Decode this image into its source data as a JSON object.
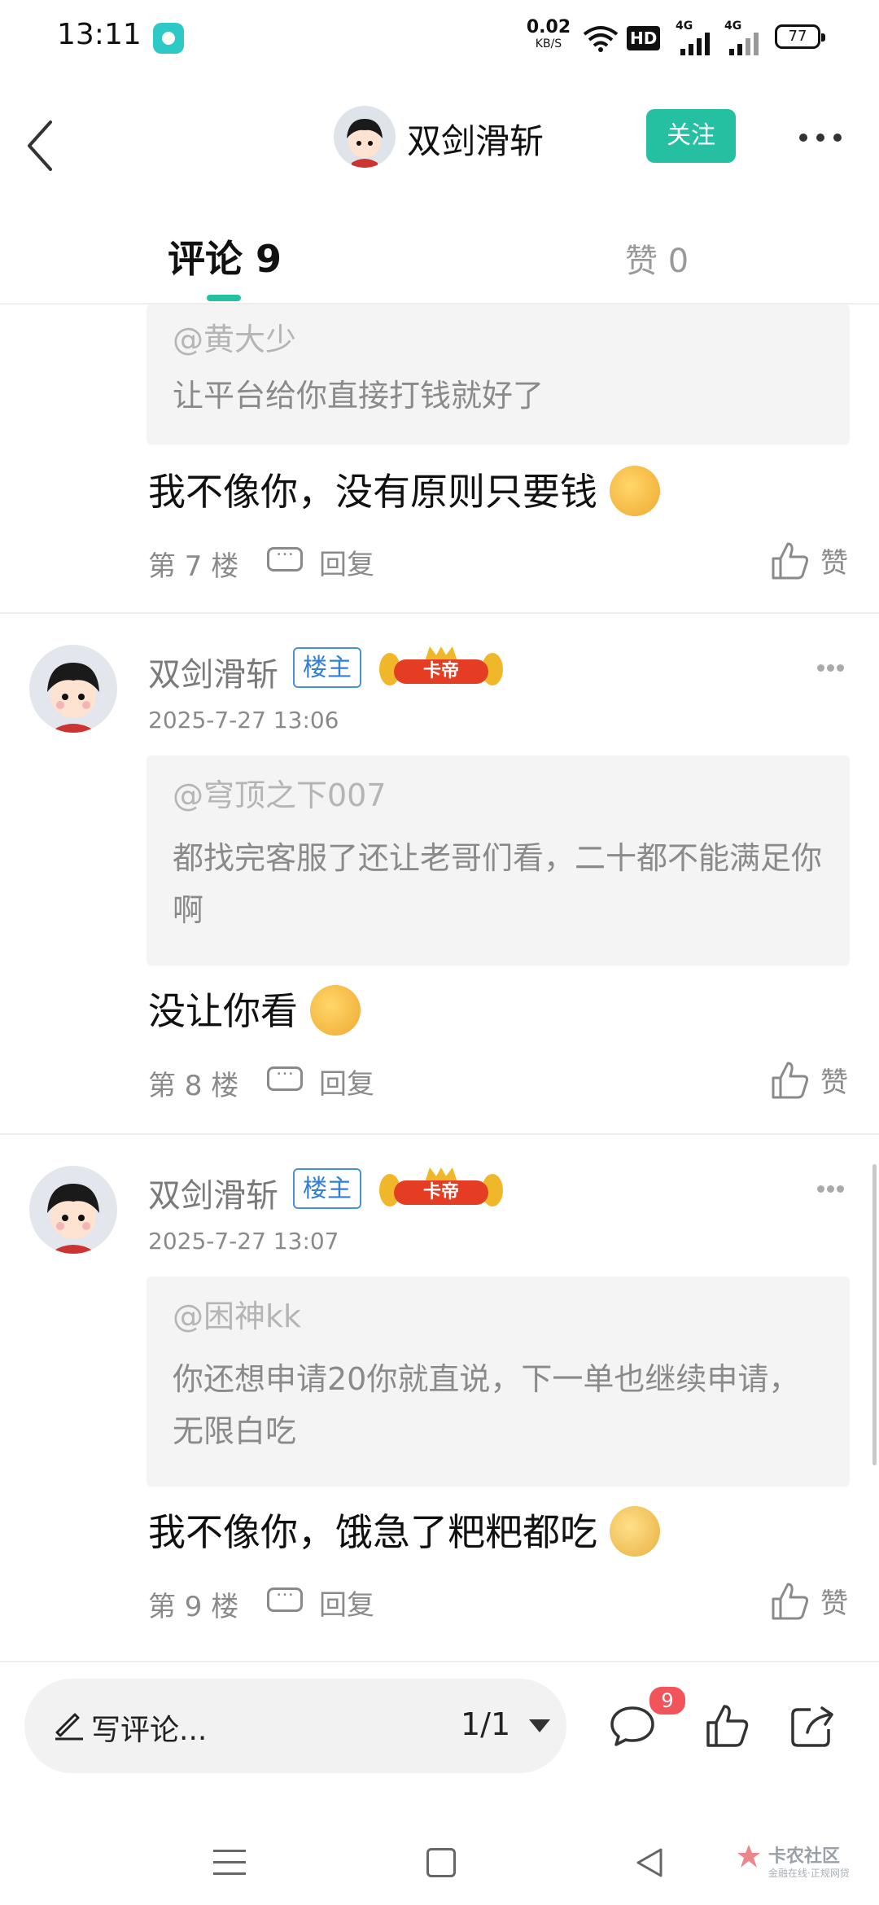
{
  "status_bar": {
    "time": "13:11",
    "net_speed_value": "0.02",
    "net_speed_unit": "KB/S",
    "hd_label": "HD",
    "signal_1": "4G",
    "signal_2": "4G",
    "battery": "77"
  },
  "header": {
    "title": "双剑滑斩",
    "follow_label": "关注"
  },
  "tabs": {
    "comments": "评论 9",
    "likes": "赞 0"
  },
  "comments": [
    {
      "quote_author": "@黄大少",
      "quote_text": "让平台给你直接打钱就好了",
      "reply": "我不像你，没有原则只要钱",
      "floor": "第 7 楼",
      "reply_label": "回复",
      "like_label": "赞"
    },
    {
      "author": "双剑滑斩",
      "host_badge": "楼主",
      "level_badge": "卡帝",
      "date": "2025-7-27 13:06",
      "quote_author": "@穹顶之下007",
      "quote_text": "都找完客服了还让老哥们看，二十都不能满足你啊",
      "reply": "没让你看",
      "floor": "第 8 楼",
      "reply_label": "回复",
      "like_label": "赞"
    },
    {
      "author": "双剑滑斩",
      "host_badge": "楼主",
      "level_badge": "卡帝",
      "date": "2025-7-27 13:07",
      "quote_author": "@困神kk",
      "quote_text": "你还想申请20你就直说，下一单也继续申请，无限白吃",
      "reply": "我不像你，饿急了粑粑都吃",
      "floor": "第 9 楼",
      "reply_label": "回复",
      "like_label": "赞"
    }
  ],
  "bottom_bar": {
    "write_placeholder": "写评论...",
    "pager": "1/1",
    "comment_count": "9"
  },
  "watermark": {
    "title": "卡农社区",
    "subtitle": "金融在线·正规网贷"
  },
  "colors": {
    "accent": "#25c0a2",
    "badge_red": "#f2545b",
    "host_blue": "#2f7fd4"
  }
}
